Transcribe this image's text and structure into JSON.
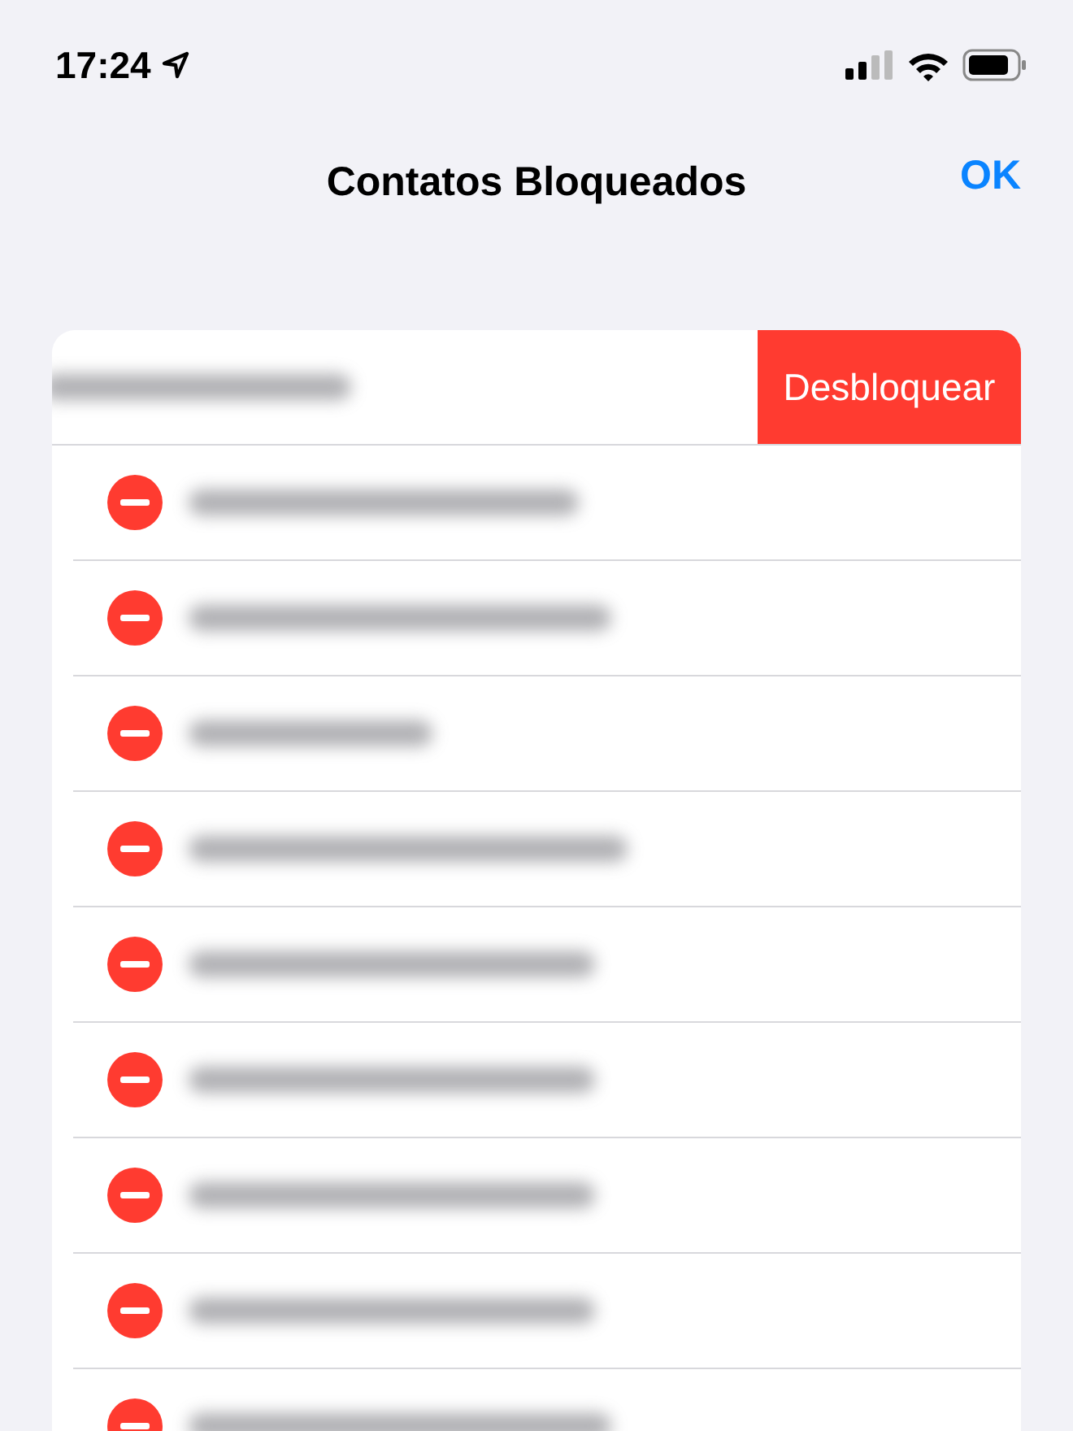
{
  "status_bar": {
    "time": "17:24"
  },
  "nav": {
    "title": "Contatos Bloqueados",
    "done": "OK"
  },
  "rows": [
    {
      "kind": "swiped",
      "action": "Desbloquear"
    },
    {
      "kind": "editing"
    },
    {
      "kind": "editing"
    },
    {
      "kind": "editing"
    },
    {
      "kind": "editing"
    },
    {
      "kind": "editing"
    },
    {
      "kind": "editing"
    },
    {
      "kind": "editing"
    },
    {
      "kind": "editing"
    },
    {
      "kind": "editing"
    }
  ]
}
